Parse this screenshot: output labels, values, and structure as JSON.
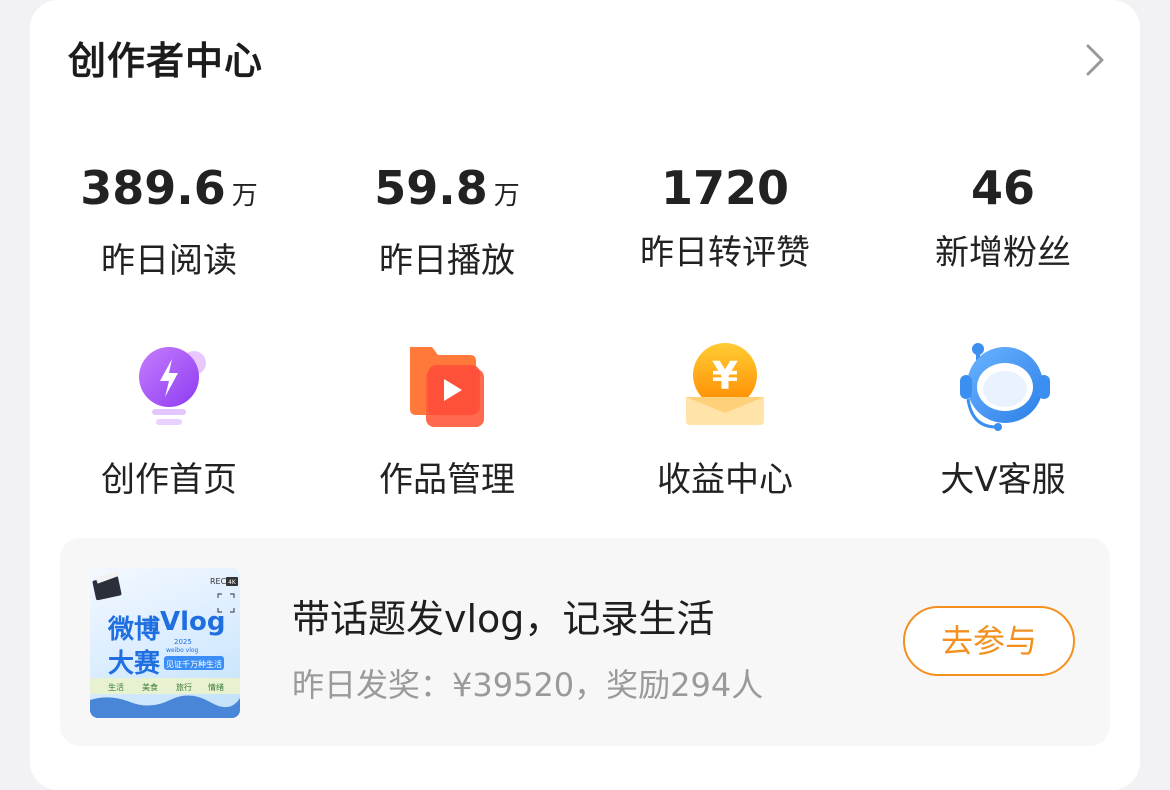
{
  "header": {
    "title": "创作者中心"
  },
  "stats": [
    {
      "value": "389.6",
      "unit": "万",
      "label": "昨日阅读"
    },
    {
      "value": "59.8",
      "unit": "万",
      "label": "昨日播放"
    },
    {
      "value": "1720",
      "unit": "",
      "label": "昨日转评赞"
    },
    {
      "value": "46",
      "unit": "",
      "label": "新增粉丝"
    }
  ],
  "tools": [
    {
      "label": "创作首页",
      "icon": "lightbulb-bolt-icon"
    },
    {
      "label": "作品管理",
      "icon": "video-folder-icon"
    },
    {
      "label": "收益中心",
      "icon": "yuan-coin-icon"
    },
    {
      "label": "大V客服",
      "icon": "headset-service-icon"
    }
  ],
  "banner": {
    "title": "带话题发vlog，记录生活",
    "subtitle": "昨日发奖：¥39520，奖励294人",
    "button": "去参与",
    "thumb": {
      "rec": "REC",
      "badge": "4K",
      "line1": "微博",
      "line1b": "Vlog",
      "line2": "大赛",
      "year": "2025",
      "sub": "weibo vlog",
      "ribbon": "见证千万种生活",
      "tags": [
        "生活",
        "美食",
        "旅行",
        "情绪"
      ]
    }
  },
  "colors": {
    "accent": "#f4901e",
    "purple": "#a64cf5",
    "orange": "#ff5a2a",
    "gold": "#ffb300",
    "blue": "#3a8ff0"
  }
}
